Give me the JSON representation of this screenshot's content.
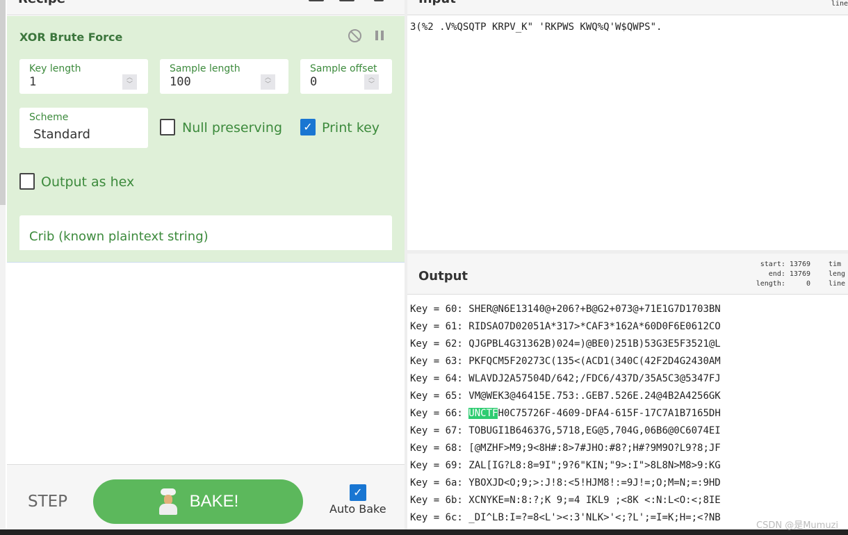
{
  "recipe": {
    "title": "Recipe",
    "operation": {
      "name": "XOR Brute Force",
      "key_length": {
        "label": "Key length",
        "value": "1"
      },
      "sample_length": {
        "label": "Sample length",
        "value": "100"
      },
      "sample_offset": {
        "label": "Sample offset",
        "value": "0"
      },
      "scheme": {
        "label": "Scheme",
        "value": "Standard"
      },
      "null_preserving": {
        "label": "Null preserving",
        "checked": false
      },
      "print_key": {
        "label": "Print key",
        "checked": true
      },
      "output_hex": {
        "label": "Output as hex",
        "checked": false
      },
      "crib": {
        "placeholder": "Crib (known plaintext string)",
        "value": ""
      }
    },
    "step_label": "STEP",
    "bake_label": "BAKE!",
    "auto_bake": {
      "label": "Auto Bake",
      "checked": true
    }
  },
  "input": {
    "title": "Input",
    "text": "3(%2 .V%QSQTP KRPV_K\" 'RKPWS KWQ%Q'W$QWPS\".",
    "lines_label": "line"
  },
  "output": {
    "title": "Output",
    "stats": {
      "start": "start: 13769",
      "end": "end: 13769",
      "length": "length:     0",
      "time": "tim",
      "len2": "leng",
      "lines": "line"
    },
    "rows": [
      {
        "prefix": "Key = 60: ",
        "highlight": "",
        "text": "SHER@N6E13140@+206?+B@G2+073@+71E1G7D1703BN"
      },
      {
        "prefix": "Key = 61: ",
        "highlight": "",
        "text": "RIDSAO7D02051A*317>*CAF3*162A*60D0F6E0612CO"
      },
      {
        "prefix": "Key = 62: ",
        "highlight": "",
        "text": "QJGPBL4G31362B)024=)@BE0)251B)53G3E5F3521@L"
      },
      {
        "prefix": "Key = 63: ",
        "highlight": "",
        "text": "PKFQCM5F20273C(135<(ACD1(340C(42F2D4G2430AM"
      },
      {
        "prefix": "Key = 64: ",
        "highlight": "",
        "text": "WLAVDJ2A57504D/642;/FDC6/437D/35A5C3@5347FJ"
      },
      {
        "prefix": "Key = 65: ",
        "highlight": "",
        "text": "VM@WEK3@46415E.753:.GEB7.526E.24@4B2A4256GK"
      },
      {
        "prefix": "Key = 66: ",
        "highlight": "UNCTF",
        "text": "H0C75726F-4609-DFA4-615F-17C7A1B7165DH"
      },
      {
        "prefix": "Key = 67: ",
        "highlight": "",
        "text": "TOBUGI1B64637G,5718,EG@5,704G,06B6@0C6074EI"
      },
      {
        "prefix": "Key = 68: ",
        "highlight": "",
        "text": "[@MZHF>M9;9<8H#:8>7#JHO:#8?;H#?9M9O?L9?8;JF"
      },
      {
        "prefix": "Key = 69: ",
        "highlight": "",
        "text": "ZAL[IG?L8:8=9I\";9?6\"KIN;\"9>:I\">8L8N>M8>9:KG"
      },
      {
        "prefix": "Key = 6a: ",
        "highlight": "",
        "text": "YBOXJD<O;9;>:J!8:<5!HJM8!:=9J!=;O;M=N;=:9HD"
      },
      {
        "prefix": "Key = 6b: ",
        "highlight": "",
        "text": "XCNYKE=N:8:?;K 9;=4 IKL9 ;<8K <:N:L<O:<;8IE"
      },
      {
        "prefix": "Key = 6c: ",
        "highlight": "",
        "text": "_DI^LB:I=?=8<L'><:3'NLK>'<;?L';=I=K;H=;<?NB"
      }
    ]
  },
  "watermark": "CSDN @是Mumuzi",
  "colors": {
    "accent": "#5cb85c",
    "op_bg": "#dff0d8",
    "label": "#3c8a3c",
    "highlight": "#2ecc71",
    "checkbox": "#1976d2"
  }
}
